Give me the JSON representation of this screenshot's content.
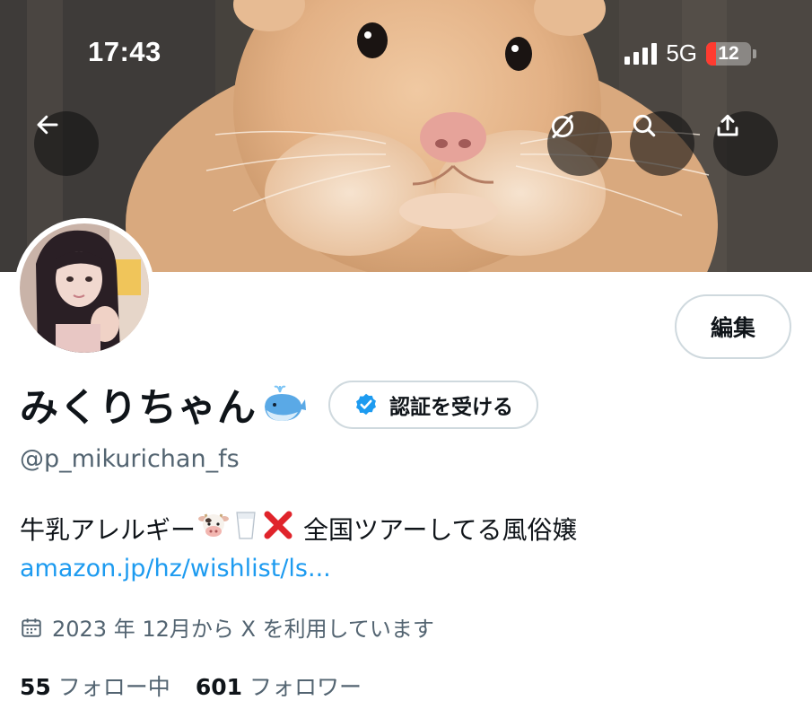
{
  "status_bar": {
    "time": "17:43",
    "network": "5G",
    "battery": "12",
    "battery_level": 0.12
  },
  "header": {
    "back_icon": "back-arrow-icon",
    "grok_icon": "grok-icon",
    "search_icon": "search-icon",
    "share_icon": "share-icon"
  },
  "profile": {
    "display_name": "みくりちゃん",
    "name_emoji": "whale-emoji",
    "verify_label": "認証を受ける",
    "edit_label": "編集",
    "handle": "@p_mikurichan_fs",
    "bio_prefix": "牛乳アレルギー",
    "bio_suffix": "全国ツアーしてる風俗嬢",
    "bio_emojis": [
      "cow-face-emoji",
      "milk-glass-emoji",
      "cross-mark-emoji"
    ],
    "link": "amazon.jp/hz/wishlist/ls...",
    "joined": "2023 年 12月から X を利用しています",
    "following_count": "55",
    "following_label": "フォロー中",
    "followers_count": "601",
    "followers_label": "フォロワー"
  },
  "colors": {
    "accent": "#1d9bf0",
    "secondary_text": "#536471",
    "border": "#cfd9de",
    "verify_badge": "#1d9bf0",
    "cross": "#e0242b"
  }
}
